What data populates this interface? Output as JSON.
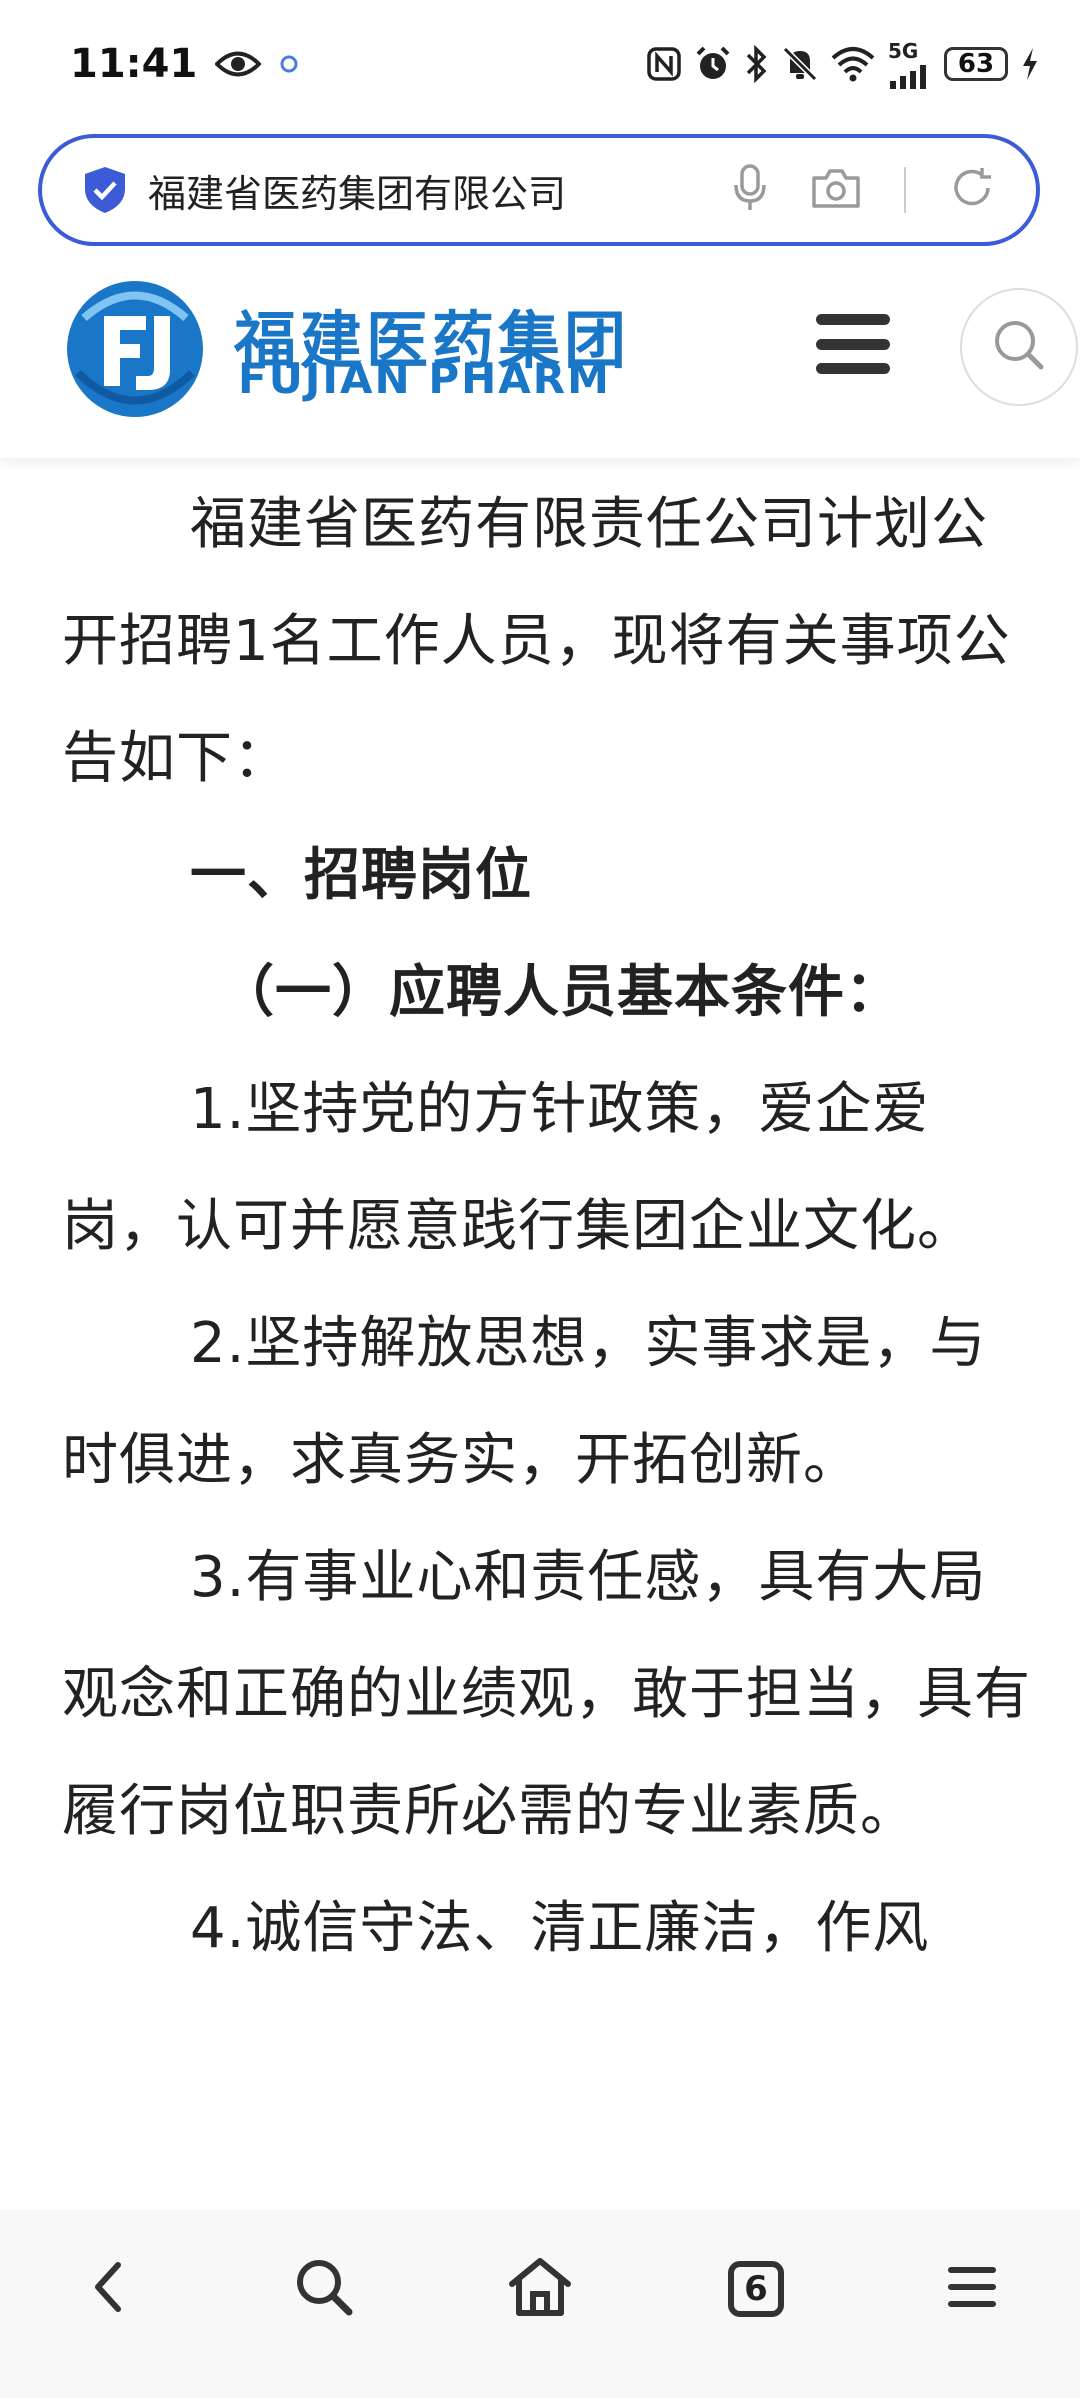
{
  "status_bar": {
    "time": "11:41",
    "network": "5G",
    "battery": "63"
  },
  "address_bar": {
    "text": "福建省医药集团有限公司"
  },
  "site_header": {
    "logo_cn": "福建医药集团",
    "logo_en": "FUJIAN PHARM"
  },
  "article": {
    "paragraphs": [
      "福建省医药有限责任公司计划公开招聘1名工作人员，现将有关事项公告如下：",
      "一、招聘岗位",
      "（一）应聘人员基本条件：",
      "1.坚持党的方针政策，爱企爱岗，认可并愿意践行集团企业文化。",
      "2.坚持解放思想，实事求是，与时俱进，求真务实，开拓创新。",
      "3.有事业心和责任感，具有大局观念和正确的业绩观，敢于担当，具有履行岗位职责所必需的专业素质。",
      "4.诚信守法、清正廉洁，作风"
    ]
  },
  "bottom_nav": {
    "tabs_count": "6"
  },
  "colors": {
    "accent": "#3d5bd6",
    "brand": "#1a76c6"
  },
  "icons": [
    "eye-icon",
    "nfc-icon",
    "alarm-icon",
    "bluetooth-icon",
    "mute-icon",
    "wifi-icon",
    "signal-icon",
    "charging-icon",
    "shield-icon",
    "mic-icon",
    "camera-icon",
    "refresh-icon",
    "menu-icon",
    "search-icon",
    "back-icon",
    "home-icon",
    "tabs-icon",
    "more-icon"
  ]
}
